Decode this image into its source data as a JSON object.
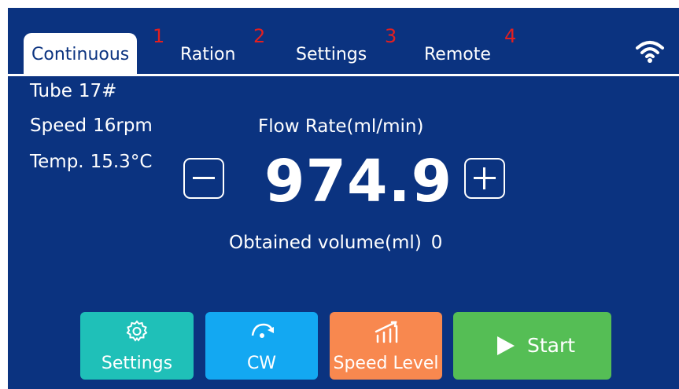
{
  "tabs": [
    {
      "label": "Continuous",
      "num": "1"
    },
    {
      "label": "Ration",
      "num": "2"
    },
    {
      "label": "Settings",
      "num": "3"
    },
    {
      "label": "Remote",
      "num": "4"
    }
  ],
  "info": {
    "tube": {
      "label": "Tube",
      "value": "17#"
    },
    "speed": {
      "label": "Speed",
      "value": "16rpm"
    },
    "temp": {
      "label": "Temp.",
      "value": "15.3°C"
    }
  },
  "flow": {
    "title": "Flow Rate(ml/min)",
    "value": "974.9"
  },
  "volume": {
    "label": "Obtained volume(ml)",
    "value": "0"
  },
  "buttons": {
    "settings": "Settings",
    "cw": "CW",
    "speed_level": "Speed Level",
    "start": "Start"
  },
  "colors": {
    "background": "#0b3380",
    "settings": "#1fc0b8",
    "cw": "#13a8f2",
    "speed_level": "#f8884f",
    "start": "#55be55",
    "tab_number": "#e41f1f"
  },
  "icons": {
    "settings": "gear-icon",
    "cw": "rotate-cw-icon",
    "speed_level": "bar-chart-icon",
    "start": "play-icon",
    "wifi": "wifi-icon"
  }
}
